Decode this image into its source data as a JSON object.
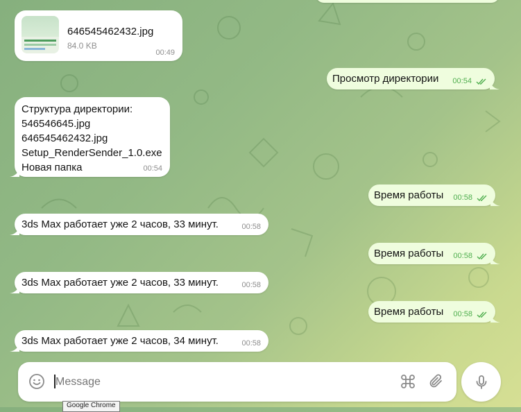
{
  "messages": [
    {
      "type": "file",
      "direction": "in",
      "file_name": "646545462432.jpg",
      "file_size": "84.0 KB",
      "time": "00:49"
    },
    {
      "type": "text",
      "direction": "out",
      "text": "Просмотр директории",
      "time": "00:54"
    },
    {
      "type": "text",
      "direction": "in",
      "lines": [
        "Структура директории:",
        "546546645.jpg",
        "646545462432.jpg",
        "Setup_RenderSender_1.0.exe",
        "Новая папка"
      ],
      "time": "00:54"
    },
    {
      "type": "text",
      "direction": "out",
      "text": "Время работы",
      "time": "00:58"
    },
    {
      "type": "text",
      "direction": "in",
      "text": "3ds Max работает уже 2 часов, 33 минут.",
      "time": "00:58"
    },
    {
      "type": "text",
      "direction": "out",
      "text": "Время работы",
      "time": "00:58"
    },
    {
      "type": "text",
      "direction": "in",
      "text": "3ds Max работает уже 2 часов, 33 минут.",
      "time": "00:58"
    },
    {
      "type": "text",
      "direction": "out",
      "text": "Время работы",
      "time": "00:58"
    },
    {
      "type": "text",
      "direction": "in",
      "text": "3ds Max работает уже 2 часов, 34 минут.",
      "time": "00:58"
    }
  ],
  "composer": {
    "placeholder": "Message"
  },
  "tooltip": {
    "text": "Google Chrome"
  },
  "icons": {
    "emoji": "emoji-icon",
    "command": "command-icon",
    "attach": "paperclip-icon",
    "mic": "microphone-icon"
  },
  "colors": {
    "outgoing_bubble": "#effdde",
    "incoming_bubble": "#ffffff",
    "tick": "#4fae4e"
  }
}
